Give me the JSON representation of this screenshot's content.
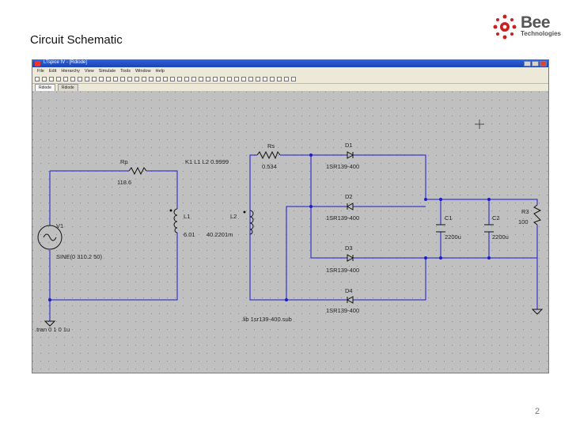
{
  "slide": {
    "title": "Circuit Schematic",
    "page_number": "2"
  },
  "logo": {
    "name": "Bee",
    "subtitle": "Technologies"
  },
  "window": {
    "title": "LTspice IV - [Rdiode]",
    "menu": [
      "File",
      "Edit",
      "Hierarchy",
      "View",
      "Simulate",
      "Tools",
      "Window",
      "Help"
    ],
    "tabs": [
      "Rdiode",
      "Rdiode"
    ]
  },
  "schematic": {
    "components": {
      "rp": {
        "name": "Rp",
        "value": "118.6"
      },
      "rs": {
        "name": "Rs",
        "value": "0.534"
      },
      "l1": {
        "name": "L1",
        "value": "6.01"
      },
      "l2": {
        "name": "L2",
        "value": "40.2201m"
      },
      "v1": {
        "name": "V1",
        "value": "SINE(0 310.2 50)"
      },
      "d1": {
        "name": "D1",
        "value": "1SR139-400"
      },
      "d2": {
        "name": "D2",
        "value": "1SR139-400"
      },
      "d3": {
        "name": "D3",
        "value": "1SR139-400"
      },
      "d4": {
        "name": "D4",
        "value": "1SR139-400"
      },
      "c1": {
        "name": "C1",
        "value": "2200u"
      },
      "c2": {
        "name": "C2",
        "value": "2200u"
      },
      "r3": {
        "name": "R3",
        "value": "100"
      }
    },
    "coupling": "K1 L1 L2 0.9999",
    "tran": ".tran 0 1 0 1u",
    "lib": ".lib 1sr139-400.sub"
  },
  "colors": {
    "wire": "#1a1ad0",
    "component": "#111111",
    "junction": "#1a1ad0",
    "canvas_bg": "#c0c0c0"
  }
}
